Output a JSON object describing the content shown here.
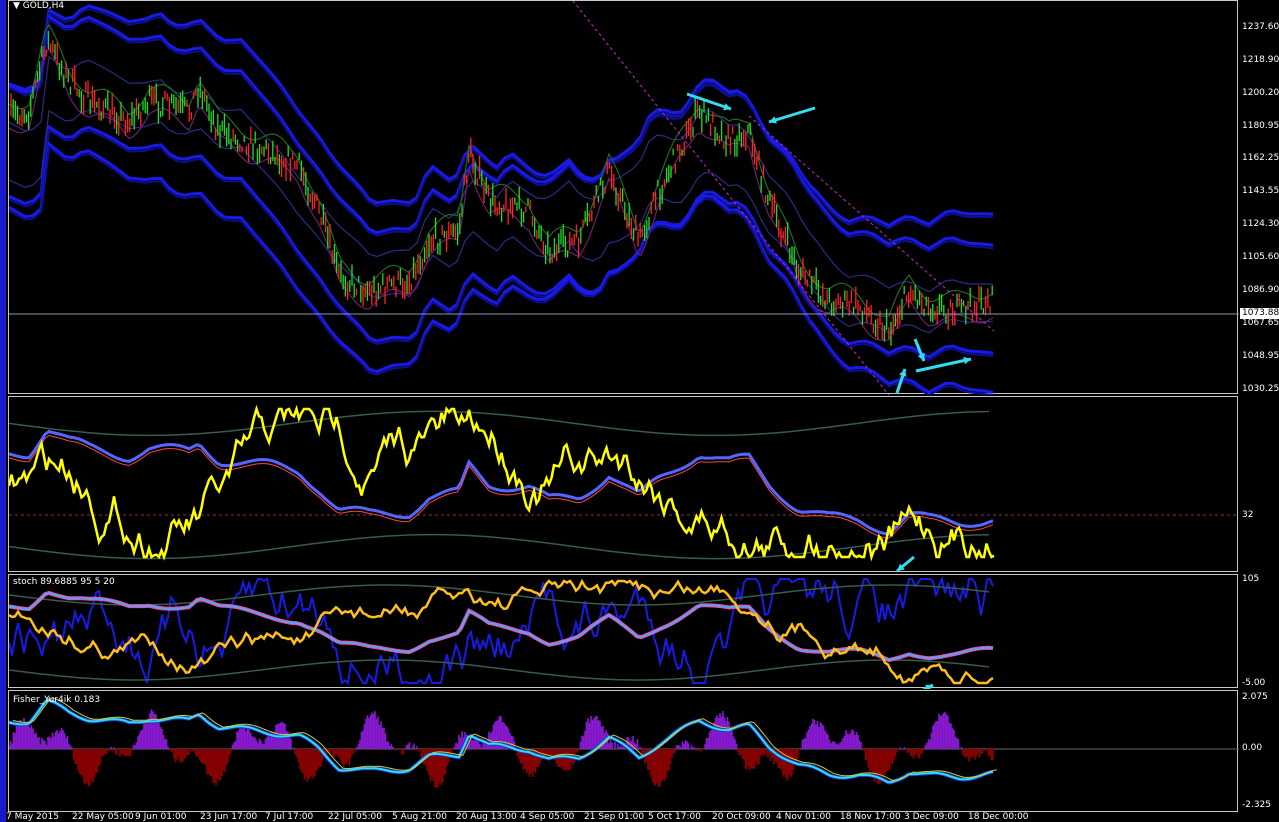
{
  "window": {
    "title": "GOLD,H4",
    "menu_glyph": "▼"
  },
  "main_price_axis": {
    "labels": [
      "1237.60",
      "1218.90",
      "1200.20",
      "1180.95",
      "1162.25",
      "1143.55",
      "1124.30",
      "1105.60",
      "1086.90",
      "1067.65",
      "1048.95",
      "1030.25"
    ],
    "current_price": "1073.88"
  },
  "ind1_axis": {
    "labels": [
      "32"
    ]
  },
  "ind2": {
    "title": "stoch 89.6885 95 5 20",
    "axis_labels": [
      "105",
      "-5.00"
    ]
  },
  "fisher": {
    "title": "Fisher_Yur4ik 0.183",
    "axis_labels": [
      "2.075",
      "0.00",
      "-2.325"
    ]
  },
  "time_axis": {
    "labels": [
      "7 May 2015",
      "22 May 05:00",
      "9 Jun 01:00",
      "23 Jun 17:00",
      "7 Jul 17:00",
      "22 Jul 05:00",
      "5 Aug 21:00",
      "20 Aug 13:00",
      "4 Sep 05:00",
      "21 Sep 01:00",
      "5 Oct 17:00",
      "20 Oct 09:00",
      "4 Nov 01:00",
      "18 Nov 17:00",
      "3 Dec 09:00",
      "18 Dec 00:00"
    ]
  },
  "colors": {
    "background": "#000000",
    "bands": "#1a1ae6",
    "price_up": "#22dd22",
    "price_down": "#ff2222",
    "yellow": "#ffff00",
    "orange": "#ffbf1a",
    "cyan": "#33ddee",
    "fisher_pos": "#8a1ad4",
    "fisher_neg": "#8b0000",
    "trend_line": "#cc22cc"
  }
}
